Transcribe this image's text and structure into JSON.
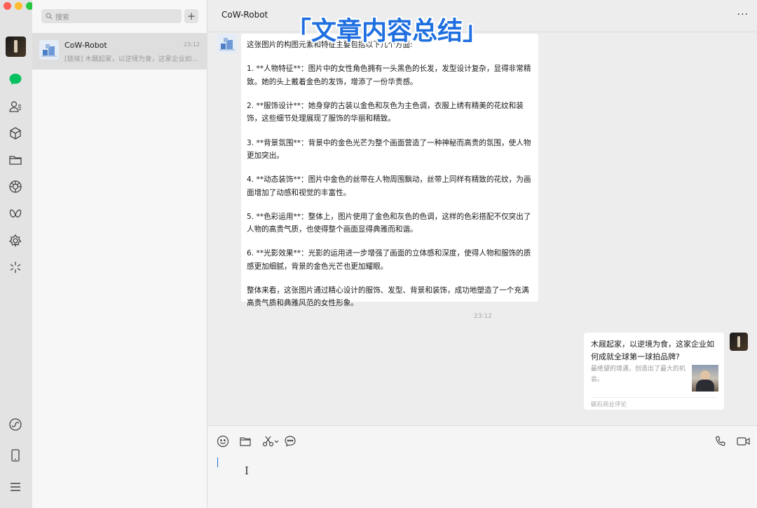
{
  "window": {
    "controls": [
      "close",
      "minimize",
      "zoom"
    ]
  },
  "rail": {
    "items": [
      {
        "name": "profile-avatar"
      },
      {
        "name": "chats-icon",
        "color": "#07c160"
      },
      {
        "name": "contacts-icon"
      },
      {
        "name": "favorites-icon"
      },
      {
        "name": "files-icon"
      },
      {
        "name": "moments-icon"
      },
      {
        "name": "channels-icon"
      },
      {
        "name": "mini-programs-icon"
      },
      {
        "name": "search-discover-icon"
      },
      {
        "name": "mini-program-panel-icon"
      },
      {
        "name": "phone-device-icon"
      },
      {
        "name": "menu-icon"
      }
    ]
  },
  "chat_list": {
    "search_placeholder": "搜索",
    "add_label": "+",
    "items": [
      {
        "name": "CoW-Robot",
        "time": "23:12",
        "preview": "[链接] 木屐起家，以逆境为食，这家企业如何成就全球第一球拍品牌?"
      }
    ]
  },
  "header": {
    "title": "CoW-Robot",
    "more_label": "···"
  },
  "overlay": {
    "title": "「文章内容总结」",
    "color": "#1f6fe0"
  },
  "messages": {
    "bot_reply": {
      "paragraphs": [
        "这张图片的构图元素和特征主要包括以下几个方面:",
        "1. **人物特征**：图片中的女性角色拥有一头黑色的长发，发型设计复杂，显得非常精致。她的头上戴着金色的发饰，增添了一份华贵感。",
        "2. **服饰设计**：她身穿的古装以金色和灰色为主色调，衣服上绣有精美的花纹和装饰，这些细节处理展现了服饰的华丽和精致。",
        "3. **背景氛围**：背景中的金色光芒为整个画面营造了一种神秘而高贵的氛围，使人物更加突出。",
        "4. **动态装饰**：图片中金色的丝带在人物周围飘动，丝带上同样有精致的花纹，为画面增加了动感和视觉的丰富性。",
        "5. **色彩运用**：整体上，图片使用了金色和灰色的色调，这样的色彩搭配不仅突出了人物的高贵气质，也使得整个画面显得典雅而和谐。",
        "6. **光影效果**：光影的运用进一步增强了画面的立体感和深度，使得人物和服饰的质感更加细腻，背景的金色光芒也更加耀眼。",
        "整体来看，这张图片通过精心设计的服饰、发型、背景和装饰，成功地塑造了一个充满高贵气质和典雅风范的女性形象。"
      ]
    },
    "timestamp": "23:12",
    "link_card": {
      "title": "木屐起家，以逆境为食，这家企业如何成就全球第一球拍品牌?",
      "description": "最绝望的境遇，创造出了最大的机会。",
      "source": "砺石商业评论"
    }
  },
  "composer": {
    "tools": [
      "emoji-icon",
      "folder-icon",
      "scissors-icon",
      "chat-history-icon"
    ],
    "right_tools": [
      "voice-call-icon",
      "video-call-icon"
    ]
  }
}
